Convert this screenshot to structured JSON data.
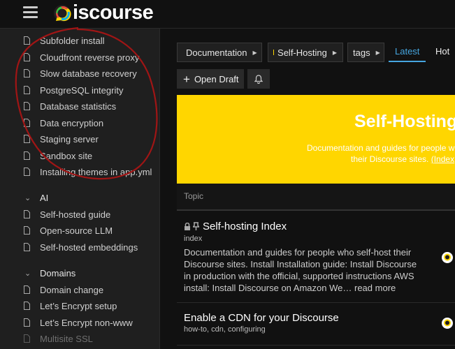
{
  "header": {
    "logo_text": "iscourse"
  },
  "sidebar": {
    "items_top": [
      {
        "label": "Subfolder install"
      },
      {
        "label": "Cloudfront reverse proxy"
      },
      {
        "label": "Slow database recovery"
      },
      {
        "label": "PostgreSQL integrity"
      },
      {
        "label": "Database statistics"
      },
      {
        "label": "Data encryption"
      },
      {
        "label": "Staging server"
      },
      {
        "label": "Sandbox site"
      },
      {
        "label": "Installing themes in app.yml"
      }
    ],
    "section_ai": "AI",
    "items_ai": [
      {
        "label": "Self-hosted guide"
      },
      {
        "label": "Open-source LLM"
      },
      {
        "label": "Self-hosted embeddings"
      }
    ],
    "section_domains": "Domains",
    "items_domains": [
      {
        "label": "Domain change"
      },
      {
        "label": "Let’s Encrypt setup"
      },
      {
        "label": "Let’s Encrypt non-www"
      },
      {
        "label": "Multisite SSL"
      }
    ]
  },
  "nav": {
    "category1": {
      "label": "Documentation",
      "color": "#2ecc40"
    },
    "category2": {
      "label": "Self-Hosting",
      "color": "#ffd600"
    },
    "tags": "tags",
    "latest": "Latest",
    "hot": "Hot"
  },
  "actions": {
    "open_draft": "Open Draft"
  },
  "banner": {
    "title": "Self-Hosting",
    "text_line1": "Documentation and guides for people w",
    "text_line2": "their Discourse sites.",
    "link": "(Index",
    "color": "#ffd600"
  },
  "topic_list": {
    "header": "Topic",
    "topics": [
      {
        "title": "Self-hosting Index",
        "tags": "index",
        "excerpt": "Documentation and guides for people who self-host their Discourse sites. Install Installation guide: Install Discourse in production with the official, supported instructions AWS install: Install Discourse on Amazon We…",
        "read_more": "read more"
      },
      {
        "title": "Enable a CDN for your Discourse",
        "tags": "how-to, cdn, configuring"
      }
    ]
  },
  "colors": {
    "accent": "#46a6e0",
    "annotation": "#a01515"
  }
}
